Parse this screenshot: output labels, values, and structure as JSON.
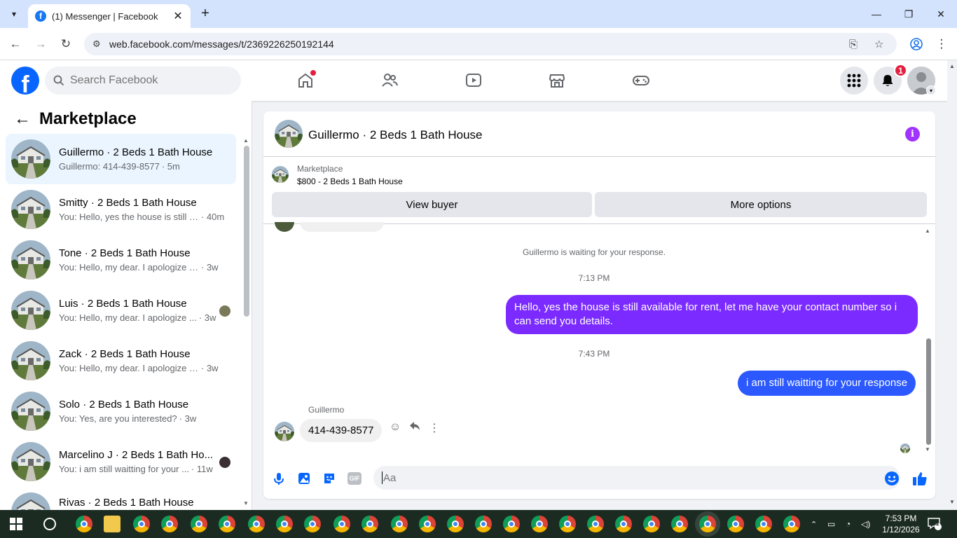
{
  "browser": {
    "tab_title": "(1) Messenger | Facebook",
    "tab_favicon": "f",
    "url": "web.facebook.com/messages/t/2369226250192144"
  },
  "fb": {
    "search_placeholder": "Search Facebook",
    "notification_count": "1",
    "logo_letter": "f"
  },
  "sidebar": {
    "title": "Marketplace",
    "conversations": [
      {
        "name": "Guillermo · 2 Beds 1 Bath House",
        "preview": "Guillermo: 414-439-8577",
        "time": "· 5m",
        "active": true
      },
      {
        "name": "Smitty · 2 Beds 1 Bath House",
        "preview": "You: Hello, yes the house is still a...",
        "time": "· 40m"
      },
      {
        "name": "Tone · 2 Beds 1 Bath House",
        "preview": "You: Hello, my dear. I apologize for...",
        "time": "· 3w"
      },
      {
        "name": "Luis · 2 Beds 1 Bath House",
        "preview": "You: Hello, my dear. I apologize ...",
        "time": "· 3w"
      },
      {
        "name": "Zack · 2 Beds 1 Bath House",
        "preview": "You: Hello, my dear. I apologize for...",
        "time": "· 3w"
      },
      {
        "name": "Solo · 2 Beds 1 Bath House",
        "preview": "You: Yes, are you interested?",
        "time": "· 3w"
      },
      {
        "name": "Marcelino J · 2 Beds 1 Bath Ho...",
        "preview": "You: i am still waitting for your ...",
        "time": "· 11w"
      },
      {
        "name": "Rivas · 2 Beds 1 Bath House",
        "preview": "",
        "time": ""
      }
    ]
  },
  "chat": {
    "name": "Guillermo · 2 Beds 1 Bath House",
    "marketplace_label": "Marketplace",
    "listing": "$800 - 2 Beds 1 Bath House",
    "view_buyer": "View buyer",
    "more_options": "More options",
    "waiting_notice": "Guillermo is waiting for your response.",
    "time1": "7:13 PM",
    "msg1": "Hello, yes the house is still available for rent, let me have your contact number so i can send you  details.",
    "time2": "7:43 PM",
    "msg2": "i am still waitting for your response",
    "sender": "Guillermo",
    "msg3": "414-439-8577",
    "composer_placeholder": "Aa",
    "gif_label": "GIF"
  },
  "taskbar": {
    "time": "7:53 PM",
    "date": "1/12/2026",
    "notif_count": "1"
  },
  "colors": {
    "fb_blue": "#0866ff",
    "bubble_purple": "#7b2bff",
    "bubble_blue": "#2b59ff",
    "badge_red": "#e41e3f"
  }
}
